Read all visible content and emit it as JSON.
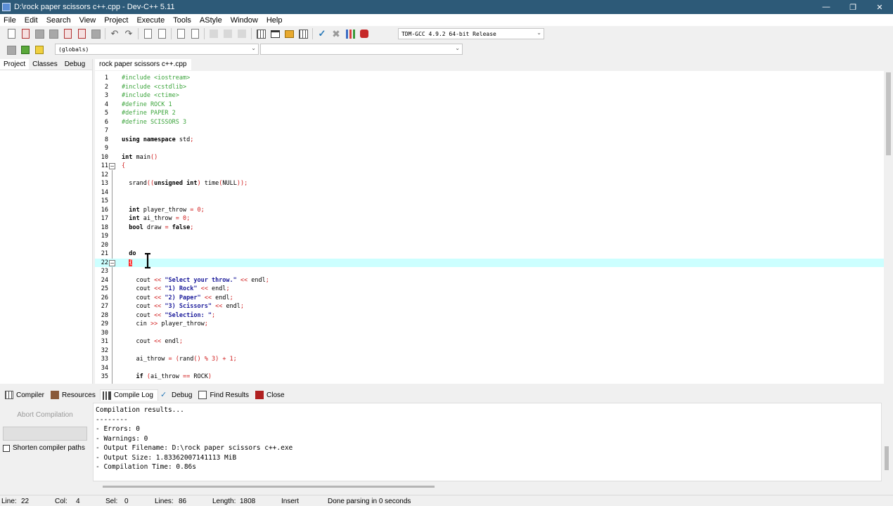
{
  "window": {
    "title": "D:\\rock paper scissors c++.cpp - Dev-C++ 5.11",
    "controls": {
      "minimize": "—",
      "restore": "❐",
      "close": "✕"
    }
  },
  "menu": [
    "File",
    "Edit",
    "Search",
    "View",
    "Project",
    "Execute",
    "Tools",
    "AStyle",
    "Window",
    "Help"
  ],
  "toolbar": {
    "compiler": "TDM-GCC 4.9.2 64-bit Release",
    "scope": "(globals)",
    "member": ""
  },
  "left_panel": {
    "tabs": [
      "Project",
      "Classes",
      "Debug"
    ]
  },
  "editor": {
    "file_tab": "rock paper scissors c++.cpp",
    "current_line": 22,
    "lines": [
      {
        "n": "1",
        "segs": [
          {
            "t": "#include <iostream>",
            "c": "pre"
          }
        ]
      },
      {
        "n": "2",
        "segs": [
          {
            "t": "#include <cstdlib>",
            "c": "pre"
          }
        ]
      },
      {
        "n": "3",
        "segs": [
          {
            "t": "#include <ctime>",
            "c": "pre"
          }
        ]
      },
      {
        "n": "4",
        "segs": [
          {
            "t": "#define ROCK 1",
            "c": "pre"
          }
        ]
      },
      {
        "n": "5",
        "segs": [
          {
            "t": "#define PAPER 2",
            "c": "pre"
          }
        ]
      },
      {
        "n": "6",
        "segs": [
          {
            "t": "#define SCISSORS 3",
            "c": "pre"
          }
        ]
      },
      {
        "n": "7",
        "segs": []
      },
      {
        "n": "8",
        "segs": [
          {
            "t": "using namespace",
            "c": "kw"
          },
          {
            "t": " std",
            "c": "txt"
          },
          {
            "t": ";",
            "c": "op"
          }
        ]
      },
      {
        "n": "9",
        "segs": []
      },
      {
        "n": "10",
        "segs": [
          {
            "t": "int",
            "c": "kw"
          },
          {
            "t": " main",
            "c": "txt"
          },
          {
            "t": "()",
            "c": "op"
          }
        ]
      },
      {
        "n": "11",
        "segs": [
          {
            "t": "{",
            "c": "op"
          }
        ],
        "fold": "−"
      },
      {
        "n": "12",
        "segs": []
      },
      {
        "n": "13",
        "segs": [
          {
            "t": "  srand",
            "c": "txt"
          },
          {
            "t": "((",
            "c": "op"
          },
          {
            "t": "unsigned int",
            "c": "kw"
          },
          {
            "t": ")",
            "c": "op"
          },
          {
            "t": " time",
            "c": "txt"
          },
          {
            "t": "(",
            "c": "op"
          },
          {
            "t": "NULL",
            "c": "txt"
          },
          {
            "t": "));",
            "c": "op"
          }
        ]
      },
      {
        "n": "14",
        "segs": []
      },
      {
        "n": "15",
        "segs": []
      },
      {
        "n": "16",
        "segs": [
          {
            "t": "  int",
            "c": "kw"
          },
          {
            "t": " player_throw ",
            "c": "txt"
          },
          {
            "t": "= 0;",
            "c": "op"
          }
        ]
      },
      {
        "n": "17",
        "segs": [
          {
            "t": "  int",
            "c": "kw"
          },
          {
            "t": " ai_throw ",
            "c": "txt"
          },
          {
            "t": "= 0;",
            "c": "op"
          }
        ]
      },
      {
        "n": "18",
        "segs": [
          {
            "t": "  bool",
            "c": "kw"
          },
          {
            "t": " draw ",
            "c": "txt"
          },
          {
            "t": "= ",
            "c": "op"
          },
          {
            "t": "false",
            "c": "kw"
          },
          {
            "t": ";",
            "c": "op"
          }
        ]
      },
      {
        "n": "19",
        "segs": []
      },
      {
        "n": "20",
        "segs": []
      },
      {
        "n": "21",
        "segs": [
          {
            "t": "  do",
            "c": "kw"
          }
        ]
      },
      {
        "n": "22",
        "segs": [
          {
            "t": "  ",
            "c": "txt"
          },
          {
            "t": "{",
            "c": "brace-hl"
          }
        ],
        "fold": "−"
      },
      {
        "n": "23",
        "segs": []
      },
      {
        "n": "24",
        "segs": [
          {
            "t": "    cout ",
            "c": "txt"
          },
          {
            "t": "<< ",
            "c": "op"
          },
          {
            "t": "\"Select your throw.\"",
            "c": "str"
          },
          {
            "t": " << ",
            "c": "op"
          },
          {
            "t": "endl",
            "c": "txt"
          },
          {
            "t": ";",
            "c": "op"
          }
        ]
      },
      {
        "n": "25",
        "segs": [
          {
            "t": "    cout ",
            "c": "txt"
          },
          {
            "t": "<< ",
            "c": "op"
          },
          {
            "t": "\"1) Rock\"",
            "c": "str"
          },
          {
            "t": " << ",
            "c": "op"
          },
          {
            "t": "endl",
            "c": "txt"
          },
          {
            "t": ";",
            "c": "op"
          }
        ]
      },
      {
        "n": "26",
        "segs": [
          {
            "t": "    cout ",
            "c": "txt"
          },
          {
            "t": "<< ",
            "c": "op"
          },
          {
            "t": "\"2) Paper\"",
            "c": "str"
          },
          {
            "t": " << ",
            "c": "op"
          },
          {
            "t": "endl",
            "c": "txt"
          },
          {
            "t": ";",
            "c": "op"
          }
        ]
      },
      {
        "n": "27",
        "segs": [
          {
            "t": "    cout ",
            "c": "txt"
          },
          {
            "t": "<< ",
            "c": "op"
          },
          {
            "t": "\"3) Scissors\"",
            "c": "str"
          },
          {
            "t": " << ",
            "c": "op"
          },
          {
            "t": "endl",
            "c": "txt"
          },
          {
            "t": ";",
            "c": "op"
          }
        ]
      },
      {
        "n": "28",
        "segs": [
          {
            "t": "    cout ",
            "c": "txt"
          },
          {
            "t": "<< ",
            "c": "op"
          },
          {
            "t": "\"Selection: \"",
            "c": "str"
          },
          {
            "t": ";",
            "c": "op"
          }
        ]
      },
      {
        "n": "29",
        "segs": [
          {
            "t": "    cin ",
            "c": "txt"
          },
          {
            "t": ">> ",
            "c": "op"
          },
          {
            "t": "player_throw",
            "c": "txt"
          },
          {
            "t": ";",
            "c": "op"
          }
        ]
      },
      {
        "n": "30",
        "segs": []
      },
      {
        "n": "31",
        "segs": [
          {
            "t": "    cout ",
            "c": "txt"
          },
          {
            "t": "<< ",
            "c": "op"
          },
          {
            "t": "endl",
            "c": "txt"
          },
          {
            "t": ";",
            "c": "op"
          }
        ]
      },
      {
        "n": "32",
        "segs": []
      },
      {
        "n": "33",
        "segs": [
          {
            "t": "    ai_throw ",
            "c": "txt"
          },
          {
            "t": "= (",
            "c": "op"
          },
          {
            "t": "rand",
            "c": "txt"
          },
          {
            "t": "() % 3) + 1;",
            "c": "op"
          }
        ]
      },
      {
        "n": "34",
        "segs": []
      },
      {
        "n": "35",
        "segs": [
          {
            "t": "    if",
            "c": "kw"
          },
          {
            "t": " (",
            "c": "op"
          },
          {
            "t": "ai_throw ",
            "c": "txt"
          },
          {
            "t": "== ",
            "c": "op"
          },
          {
            "t": "ROCK",
            "c": "txt"
          },
          {
            "t": ")",
            "c": "op"
          }
        ]
      }
    ]
  },
  "bottom_tabs": [
    {
      "label": "Compiler",
      "icon": "compiler"
    },
    {
      "label": "Resources",
      "icon": "resources"
    },
    {
      "label": "Compile Log",
      "icon": "log",
      "active": true
    },
    {
      "label": "Debug",
      "icon": "debug"
    },
    {
      "label": "Find Results",
      "icon": "find"
    },
    {
      "label": "Close",
      "icon": "close"
    }
  ],
  "compile_panel": {
    "abort_label": "Abort Compilation",
    "shorten_label": "Shorten compiler paths",
    "shorten_checked": false,
    "log": [
      "Compilation results...",
      "--------",
      "- Errors: 0",
      "- Warnings: 0",
      "- Output Filename: D:\\rock paper scissors c++.exe",
      "- Output Size: 1.83362007141113 MiB",
      "- Compilation Time: 0.86s"
    ]
  },
  "status": {
    "line_label": "Line:",
    "line": "22",
    "col_label": "Col:",
    "col": "4",
    "sel_label": "Sel:",
    "sel": "0",
    "lines_label": "Lines:",
    "lines": "86",
    "length_label": "Length:",
    "length": "1808",
    "mode": "Insert",
    "message": "Done parsing in 0 seconds"
  }
}
